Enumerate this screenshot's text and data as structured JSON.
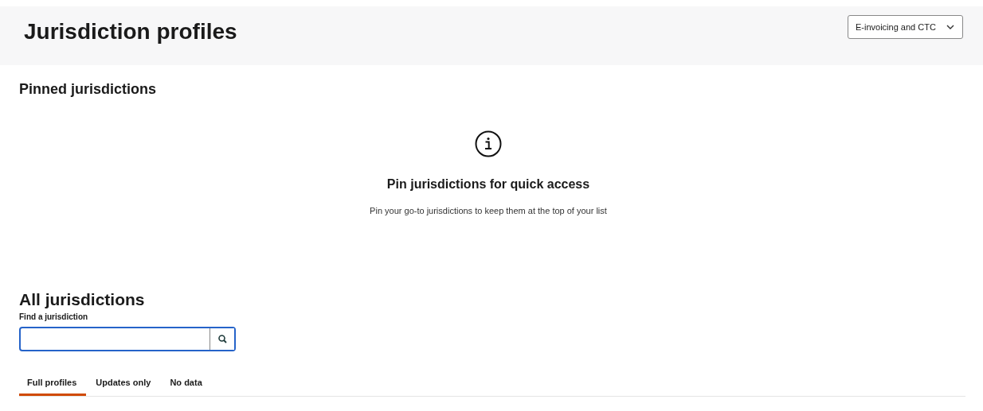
{
  "header": {
    "title": "Jurisdiction profiles",
    "dropdown": {
      "value": "E-invoicing and CTC"
    }
  },
  "pinned": {
    "heading": "Pinned jurisdictions",
    "empty_title": "Pin jurisdictions for quick access",
    "empty_text": "Pin your go-to jurisdictions to keep them at the top of your list"
  },
  "all": {
    "heading": "All jurisdictions",
    "search": {
      "label": "Find a jurisdiction"
    },
    "tabs": [
      {
        "label": "Full profiles",
        "selected": true
      },
      {
        "label": "Updates only",
        "selected": false
      },
      {
        "label": "No data",
        "selected": false
      }
    ]
  }
}
